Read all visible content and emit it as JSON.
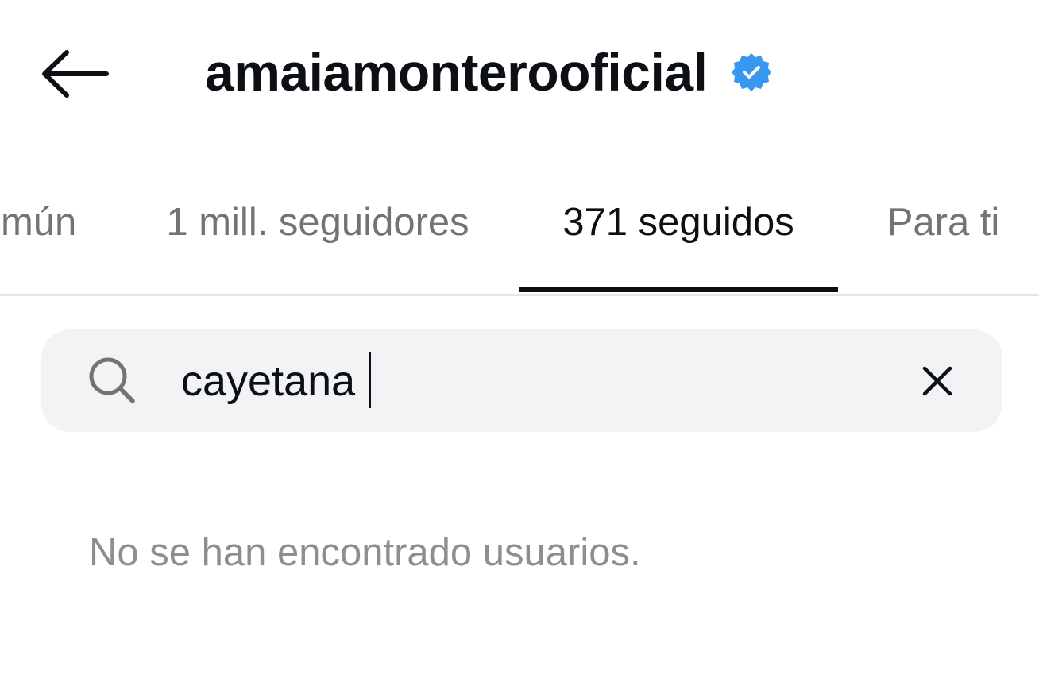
{
  "header": {
    "back_icon": "arrow-left-icon",
    "title": "amaiamonterooficial",
    "verified_icon": "verified-badge-icon",
    "verified_color": "#3897f0"
  },
  "tabs": [
    {
      "label": "omún",
      "active": false
    },
    {
      "label": "1 mill. seguidores",
      "active": false
    },
    {
      "label": "371 seguidos",
      "active": true
    },
    {
      "label": "Para ti",
      "active": false
    }
  ],
  "search": {
    "icon": "search-icon",
    "value": "cayetana",
    "clear_icon": "close-icon"
  },
  "results": {
    "empty_message": "No se han encontrado usuarios."
  },
  "colors": {
    "text_primary": "#0c1014",
    "text_secondary": "#737373",
    "search_bg": "#f2f3f5",
    "divider": "#e6e6e6"
  }
}
